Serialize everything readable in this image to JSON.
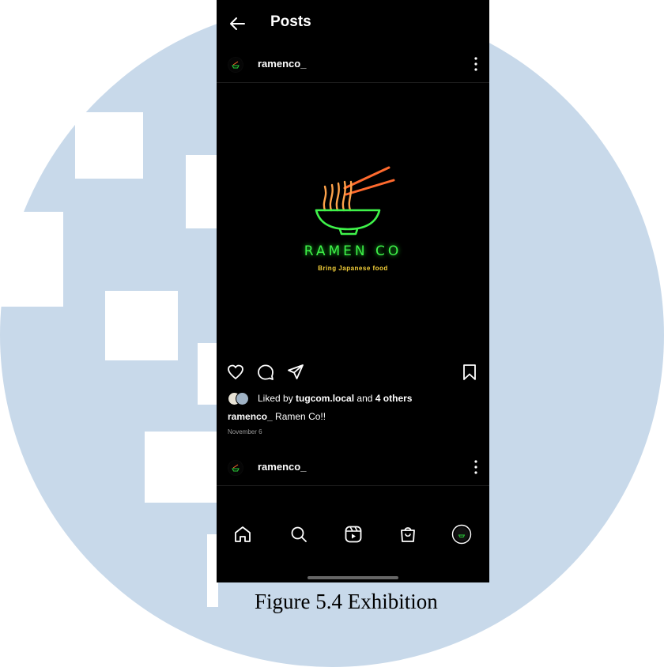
{
  "colors": {
    "background_shape": "#c8d9ea",
    "phone_background": "#000000",
    "neon_green": "#3ff24a",
    "neon_orange": "#ff6a2e",
    "neon_yellow": "#f7d23a"
  },
  "header": {
    "title": "Posts",
    "back_icon": "arrow-left-icon"
  },
  "post": {
    "username": "ramenco_",
    "menu_icon": "more-vertical-icon",
    "image": {
      "brand_name": "RAMEN CO",
      "tagline": "Bring Japanese food"
    },
    "actions": [
      "heart-icon",
      "comment-icon",
      "share-icon",
      "bookmark-icon"
    ],
    "likes_prefix": "Liked by",
    "likes_user": "tugcom.local",
    "likes_and": "and",
    "likes_others": "4 others",
    "caption_user": "ramenco_",
    "caption_text": "Ramen Co!!",
    "date": "November 6"
  },
  "next_post": {
    "username": "ramenco_"
  },
  "bottom_nav": [
    "home-icon",
    "search-icon",
    "reels-icon",
    "shop-icon",
    "profile-icon"
  ],
  "figure_caption": "Figure 5.4 Exhibition"
}
